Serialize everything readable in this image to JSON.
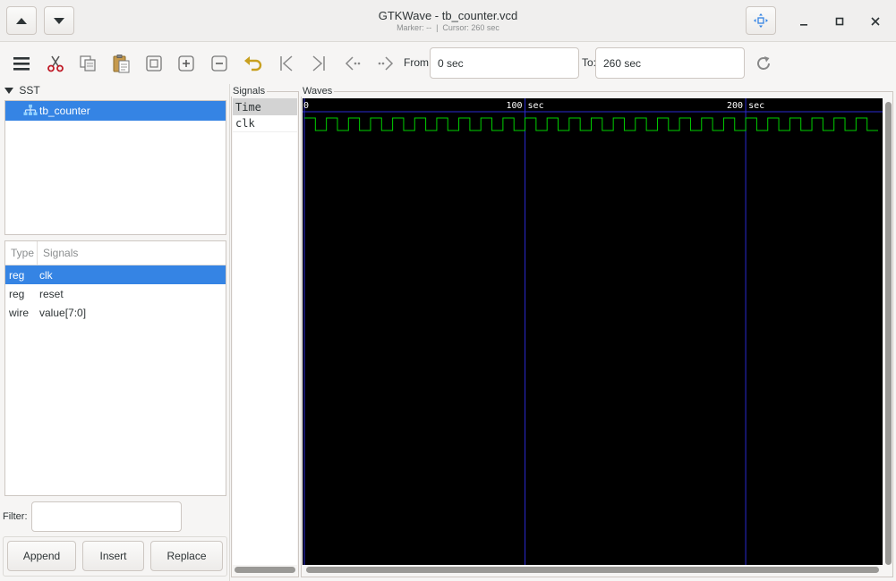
{
  "window": {
    "title": "GTKWave - tb_counter.vcd",
    "marker_text": "Marker: --",
    "separator": "|",
    "cursor_text": "Cursor: 260 sec"
  },
  "toolbar": {
    "from_label": "From:",
    "from_value": "0 sec",
    "to_label": "To:",
    "to_value": "260 sec",
    "icons": [
      "menu-icon",
      "cut-icon",
      "copy-icon",
      "paste-icon",
      "zoom-fit-icon",
      "zoom-in-icon",
      "zoom-out-icon",
      "undo-icon",
      "go-to-start-icon",
      "go-to-end-icon",
      "previous-edge-icon",
      "next-edge-icon",
      "reload-icon"
    ]
  },
  "sst": {
    "label": "SST",
    "tree": [
      {
        "label": "tb_counter",
        "selected": true
      }
    ],
    "columns": {
      "type": "Type",
      "signals": "Signals"
    },
    "signals": [
      {
        "type": "reg",
        "name": "clk",
        "selected": true
      },
      {
        "type": "reg",
        "name": "reset",
        "selected": false
      },
      {
        "type": "wire",
        "name": "value[7:0]",
        "selected": false
      }
    ],
    "filter_label": "Filter:",
    "filter_value": "",
    "buttons": {
      "append": "Append",
      "insert": "Insert",
      "replace": "Replace"
    }
  },
  "signals_pane": {
    "label": "Signals",
    "rows": [
      {
        "name": "Time",
        "highlighted": true
      },
      {
        "name": "clk",
        "highlighted": false
      }
    ]
  },
  "waves_pane": {
    "label": "Waves",
    "time_range": [
      0,
      260
    ],
    "ruler_ticks": [
      {
        "value": 0,
        "label": "0",
        "unit": ""
      },
      {
        "value": 100,
        "label": "100",
        "unit": "sec"
      },
      {
        "value": 200,
        "label": "200",
        "unit": "sec"
      }
    ],
    "clock": {
      "name": "clk",
      "period": 10,
      "high_first": true
    },
    "colors": {
      "background": "#000000",
      "wave": "#00d000",
      "grid": "#2a2ad0",
      "ruler_text": "#ffffff"
    }
  }
}
